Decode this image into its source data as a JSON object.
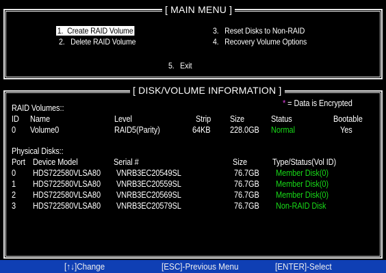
{
  "main_menu": {
    "title": "[ MAIN MENU ]",
    "items": [
      {
        "num": "1.",
        "label": "Create RAID Volume"
      },
      {
        "num": "2.",
        "label": "Delete RAID Volume"
      },
      {
        "num": "3.",
        "label": "Reset Disks to Non-RAID"
      },
      {
        "num": "4.",
        "label": "Recovery Volume Options"
      },
      {
        "num": "5.",
        "label": "Exit"
      }
    ],
    "selected_index": 0
  },
  "info": {
    "title": "[ DISK/VOLUME INFORMATION ]",
    "encrypted_mark": "*",
    "encrypted_note": "= Data is Encrypted",
    "raid_volumes_heading": "RAID Volumes::",
    "volume_headers": {
      "id": "ID",
      "name": "Name",
      "level": "Level",
      "strip": "Strip",
      "size": "Size",
      "status": "Status",
      "bootable": "Bootable"
    },
    "volumes": [
      {
        "id": "0",
        "name": "Volume0",
        "level": "RAID5(Parity)",
        "strip": "64KB",
        "size": "228.0GB",
        "status": "Normal",
        "bootable": "Yes"
      }
    ],
    "physical_heading": "Physical Disks::",
    "disk_headers": {
      "port": "Port",
      "model": "Device Model",
      "serial": "Serial #",
      "size": "Size",
      "type": "Type/Status(Vol ID)"
    },
    "disks": [
      {
        "port": "0",
        "model": "HDS722580VLSA80",
        "serial": "VNRB3EC20549SL",
        "size": "76.7GB",
        "type": "Member Disk(0)"
      },
      {
        "port": "1",
        "model": "HDS722580VLSA80",
        "serial": "VNRB3EC20559SL",
        "size": "76.7GB",
        "type": "Member Disk(0)"
      },
      {
        "port": "2",
        "model": "HDS722580VLSA80",
        "serial": "VNRB3EC20569SL",
        "size": "76.7GB",
        "type": "Member Disk(0)"
      },
      {
        "port": "3",
        "model": "HDS722580VLSA80",
        "serial": "VNRB3EC20579SL",
        "size": "76.7GB",
        "type": "Non-RAID Disk"
      }
    ]
  },
  "footer": {
    "change": "[↑↓]Change",
    "previous": "[ESC]-Previous Menu",
    "select": "[ENTER]-Select"
  },
  "colors": {
    "background": "#000000",
    "text": "#ffffff",
    "status_green": "#18d818",
    "encrypted_magenta": "#e040e0",
    "footer_bg": "#0f3fb4"
  }
}
